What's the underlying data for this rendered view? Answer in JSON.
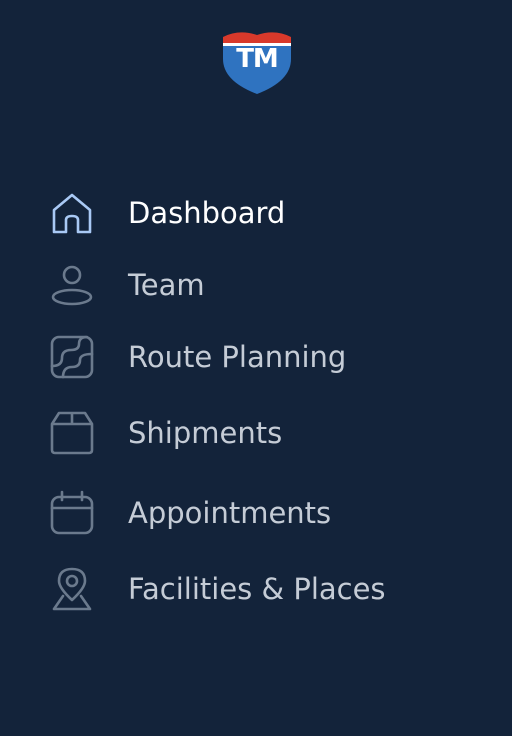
{
  "brand": {
    "logo_text": "TM",
    "colors": {
      "shield_red": "#d8392b",
      "shield_blue": "#2f73c0",
      "background": "#13233a",
      "icon_inactive": "#6b7a8d",
      "icon_active": "#a9c9f5"
    }
  },
  "nav": {
    "items": [
      {
        "label": "Dashboard",
        "icon": "home-icon",
        "active": true
      },
      {
        "label": "Team",
        "icon": "user-icon",
        "active": false
      },
      {
        "label": "Route Planning",
        "icon": "route-map-icon",
        "active": false
      },
      {
        "label": "Shipments",
        "icon": "box-icon",
        "active": false
      },
      {
        "label": "Appointments",
        "icon": "calendar-icon",
        "active": false
      },
      {
        "label": "Facilities & Places",
        "icon": "map-pin-icon",
        "active": false
      }
    ]
  }
}
